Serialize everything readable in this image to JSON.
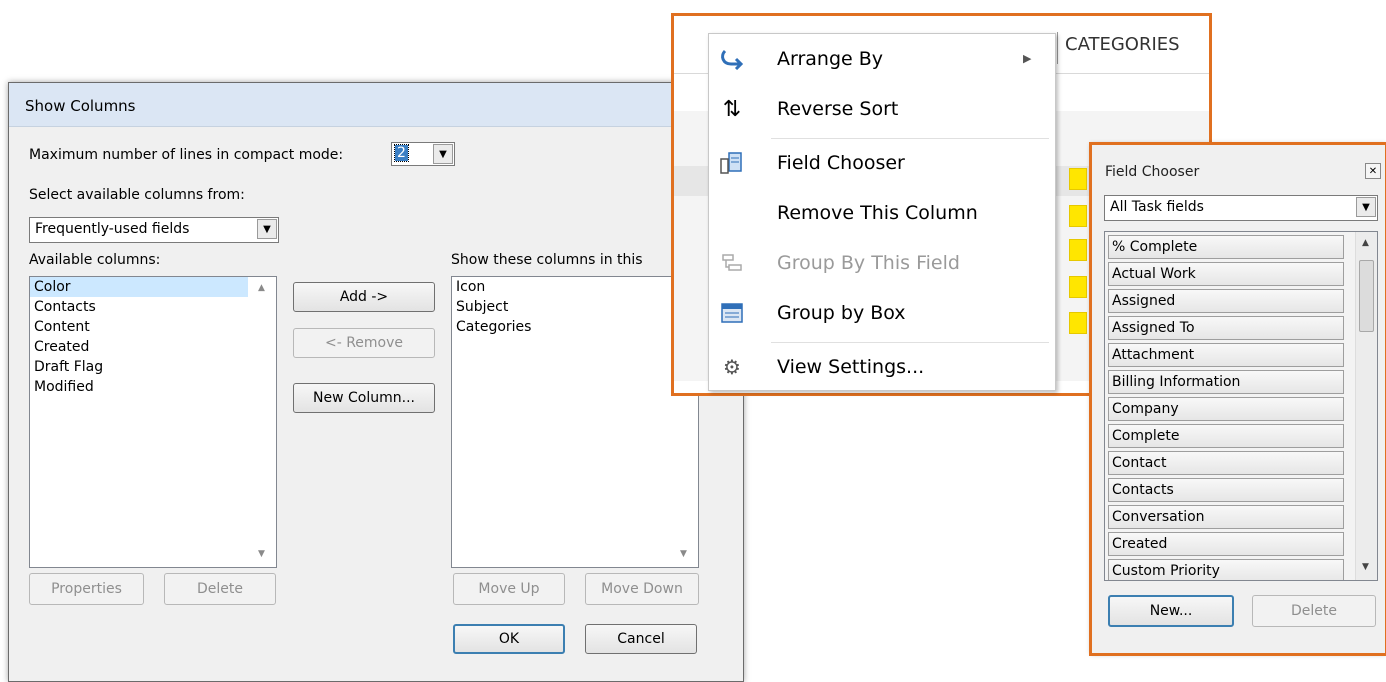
{
  "show_columns": {
    "title": "Show Columns",
    "max_lines_label": "Maximum number of lines in compact mode:",
    "max_lines_value": "2",
    "select_from_label": "Select available columns from:",
    "select_from_value": "Frequently-used fields",
    "available_label": "Available columns:",
    "available_columns": [
      "Color",
      "Contacts",
      "Content",
      "Created",
      "Draft Flag",
      "Modified"
    ],
    "show_label": "Show these columns in this",
    "shown_columns": [
      "Icon",
      "Subject",
      "Categories"
    ],
    "add_label": "Add ->",
    "remove_label": "<- Remove",
    "new_column_label": "New Column...",
    "properties_label": "Properties",
    "delete_label": "Delete",
    "move_up_label": "Move Up",
    "move_down_label": "Move Down",
    "ok_label": "OK",
    "cancel_label": "Cancel"
  },
  "context_menu": {
    "header_text": "CATEGORIES",
    "items": [
      {
        "label": "Arrange By",
        "icon": "arrange-by-icon",
        "enabled": true,
        "submenu": true
      },
      {
        "label": "Reverse Sort",
        "icon": "reverse-sort-icon",
        "enabled": true
      },
      {
        "label": "Field Chooser",
        "icon": "field-chooser-icon",
        "enabled": true
      },
      {
        "label": "Remove This Column",
        "icon": "",
        "enabled": true
      },
      {
        "label": "Group By This Field",
        "icon": "group-by-field-icon",
        "enabled": false
      },
      {
        "label": "Group by Box",
        "icon": "group-by-box-icon",
        "enabled": true
      },
      {
        "label": "View Settings...",
        "icon": "view-settings-icon",
        "enabled": true
      }
    ],
    "colors": {
      "frame": "#e07020",
      "category_fill": "#ffe600"
    }
  },
  "field_chooser": {
    "title": "Field Chooser",
    "filter_value": "All Task fields",
    "fields": [
      "% Complete",
      "Actual Work",
      "Assigned",
      "Assigned To",
      "Attachment",
      "Billing Information",
      "Company",
      "Complete",
      "Contact",
      "Contacts",
      "Conversation",
      "Created",
      "Custom Priority"
    ],
    "new_label": "New...",
    "delete_label": "Delete"
  }
}
